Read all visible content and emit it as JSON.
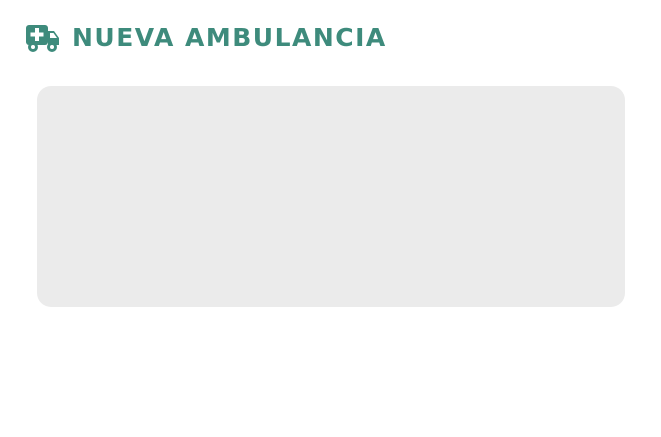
{
  "header": {
    "title": "NUEVA AMBULANCIA",
    "icon": "ambulance-icon"
  },
  "colors": {
    "accent": "#3e8b7c",
    "panel_background": "#ebebeb",
    "page_background": "#ffffff"
  }
}
